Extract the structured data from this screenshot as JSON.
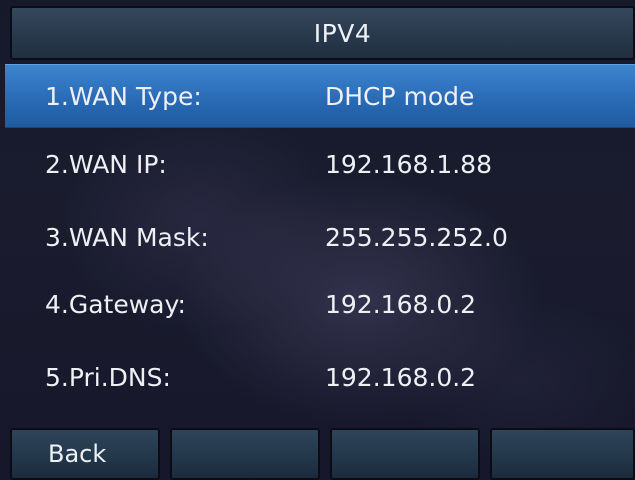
{
  "header": {
    "title": "IPV4"
  },
  "rows": [
    {
      "label": "1.WAN Type:",
      "value": "DHCP mode",
      "selected": true
    },
    {
      "label": "2.WAN IP:",
      "value": "192.168.1.88",
      "selected": false
    },
    {
      "label": "3.WAN Mask:",
      "value": "255.255.252.0",
      "selected": false
    },
    {
      "label": "4.Gateway:",
      "value": "192.168.0.2",
      "selected": false
    },
    {
      "label": "5.Pri.DNS:",
      "value": "192.168.0.2",
      "selected": false
    }
  ],
  "softkeys": [
    {
      "label": "Back"
    },
    {
      "label": ""
    },
    {
      "label": ""
    },
    {
      "label": ""
    }
  ],
  "colors": {
    "selection": "#2a6bb6",
    "bar": "#2a3a4e",
    "text": "#eef2f6"
  }
}
